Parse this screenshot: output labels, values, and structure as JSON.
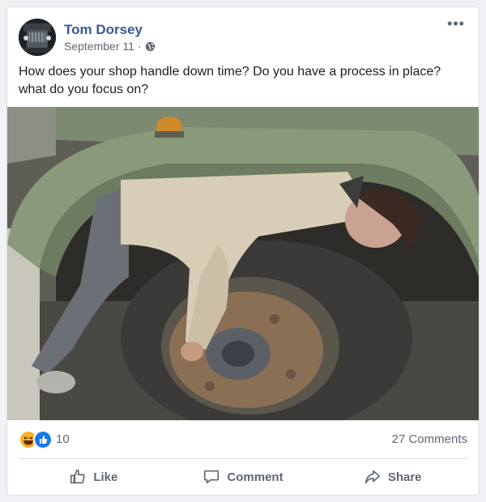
{
  "post": {
    "author": "Tom Dorsey",
    "date": "September 11",
    "separator": "·",
    "audience_icon": "globe-icon",
    "more_icon": "more-options-icon",
    "text": "How does your shop handle down time? Do you have a process in place? what do you focus on?"
  },
  "reactions": {
    "icons": [
      "haha-emoji-icon",
      "like-reaction-icon"
    ],
    "count": "10",
    "comments": "27 Comments"
  },
  "actions": {
    "like": "Like",
    "comment": "Comment",
    "share": "Share"
  },
  "colors": {
    "author": "#385898",
    "secondary_text": "#606770",
    "like_blue": "#1877f2",
    "haha_yellow": "#f7b125"
  }
}
